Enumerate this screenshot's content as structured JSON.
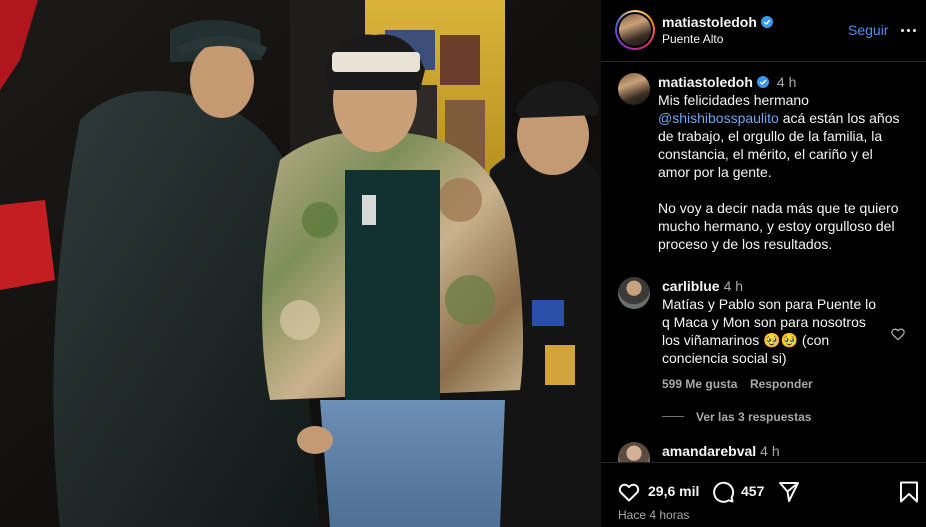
{
  "post": {
    "author": "matiastoledoh",
    "location": "Puente Alto",
    "follow_label": "Seguir",
    "time_ago": "Hace 4 horas"
  },
  "caption": {
    "username": "matiastoledoh",
    "time": "4 h",
    "line1": "Mis felicidades hermano",
    "mention": "@shishibosspaulito",
    "rest_first": " acá están los años",
    "lines": [
      "de trabajo, el orgullo de la familia, la",
      "constancia, el mérito, el cariño y el",
      "amor por la gente."
    ],
    "paragraph2": [
      "No voy a decir nada más que te quiero",
      "mucho hermano, y estoy orgulloso del",
      "proceso y de los resultados."
    ]
  },
  "comments": [
    {
      "username": "carliblue",
      "time": "4 h",
      "lines": [
        "Matías y Pablo son para Puente lo",
        "q Maca y Mon son para nosotros",
        "los viñamarinos 🥹🥹 (con",
        "conciencia social si)"
      ],
      "likes": "599 Me gusta",
      "reply_label": "Responder",
      "view_replies": "Ver las 3 respuestas"
    },
    {
      "username": "amandarebval",
      "time": "4 h"
    }
  ],
  "actions": {
    "likes_count": "29,6 mil",
    "comments_count": "457"
  },
  "icons": {
    "verified": "verified-badge-icon",
    "more": "more-options-icon",
    "like": "heart-icon",
    "comment": "comment-bubble-icon",
    "share": "share-send-icon",
    "save": "bookmark-icon"
  },
  "colors": {
    "link": "#4c8ef5",
    "verified": "#3897f0",
    "muted": "#a8a8a8"
  }
}
